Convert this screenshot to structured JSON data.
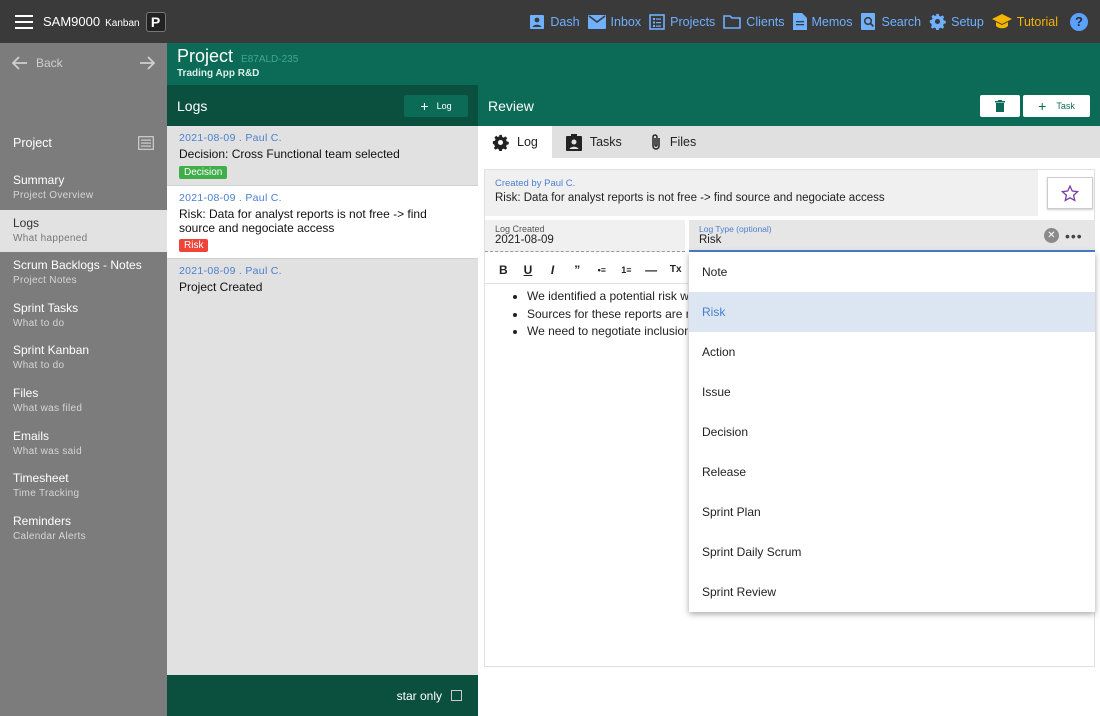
{
  "topbar": {
    "app_name": "SAM9000",
    "app_sub": "Kanban",
    "badge": "P",
    "nav": [
      {
        "label": "Dash",
        "icon": "dashboard-icon"
      },
      {
        "label": "Inbox",
        "icon": "mail-icon"
      },
      {
        "label": "Projects",
        "icon": "projects-icon"
      },
      {
        "label": "Clients",
        "icon": "folder-icon"
      },
      {
        "label": "Memos",
        "icon": "memo-icon"
      },
      {
        "label": "Search",
        "icon": "search-icon"
      },
      {
        "label": "Setup",
        "icon": "gear-icon"
      },
      {
        "label": "Tutorial",
        "icon": "graduation-cap-icon"
      }
    ],
    "help": "?"
  },
  "sidebar": {
    "back": "Back",
    "section": "Project",
    "items": [
      {
        "title": "Summary",
        "sub": "Project Overview"
      },
      {
        "title": "Logs",
        "sub": "What happened"
      },
      {
        "title": "Scrum Backlogs - Notes",
        "sub": "Project Notes"
      },
      {
        "title": "Sprint Tasks",
        "sub": "What to do"
      },
      {
        "title": "Sprint Kanban",
        "sub": "What to do"
      },
      {
        "title": "Files",
        "sub": "What was filed"
      },
      {
        "title": "Emails",
        "sub": "What was said"
      },
      {
        "title": "Timesheet",
        "sub": "Time Tracking"
      },
      {
        "title": "Reminders",
        "sub": "Calendar Alerts"
      }
    ]
  },
  "project": {
    "title": "Project",
    "code": "E87ALD-235",
    "subtitle": "Trading App R&D"
  },
  "logs": {
    "title": "Logs",
    "add_label": "Log",
    "items": [
      {
        "meta": "2021-08-09 . Paul C.",
        "text": "Decision: Cross Functional team selected",
        "tag": "Decision"
      },
      {
        "meta": "2021-08-09 . Paul C.",
        "text": "Risk: Data for analyst reports is not free -> find source and negociate access",
        "tag": "Risk"
      },
      {
        "meta": "2021-08-09 . Paul C.",
        "text": "Project Created",
        "tag": ""
      }
    ],
    "footer": "star only"
  },
  "review": {
    "title": "Review",
    "task_label": "Task",
    "tabs": [
      "Log",
      "Tasks",
      "Files"
    ],
    "created_label": "Created by Paul C.",
    "created_value": "Risk: Data for analyst reports is not free -> find source and negociate access",
    "date_label": "Log Created",
    "date_value": "2021-08-09",
    "type_label": "Log Type (optional)",
    "type_value": "Risk",
    "toolbar": [
      "B",
      "U",
      "I",
      "”",
      "•≡",
      "1≡",
      "—",
      "Tx"
    ],
    "editor_lines": [
      "We identified a potential risk wit",
      "Sources for these reports are no",
      "We need to negotiate inclusion a"
    ]
  },
  "dropdown": {
    "options": [
      "Note",
      "Risk",
      "Action",
      "Issue",
      "Decision",
      "Release",
      "Sprint Plan",
      "Sprint Daily Scrum",
      "Sprint Review"
    ],
    "selected": "Risk"
  },
  "colors": {
    "teal": "#0c6b57",
    "dark_teal": "#0b4f3f",
    "accent_blue": "#4a7fd0",
    "tutorial_gold": "#f4b400"
  }
}
